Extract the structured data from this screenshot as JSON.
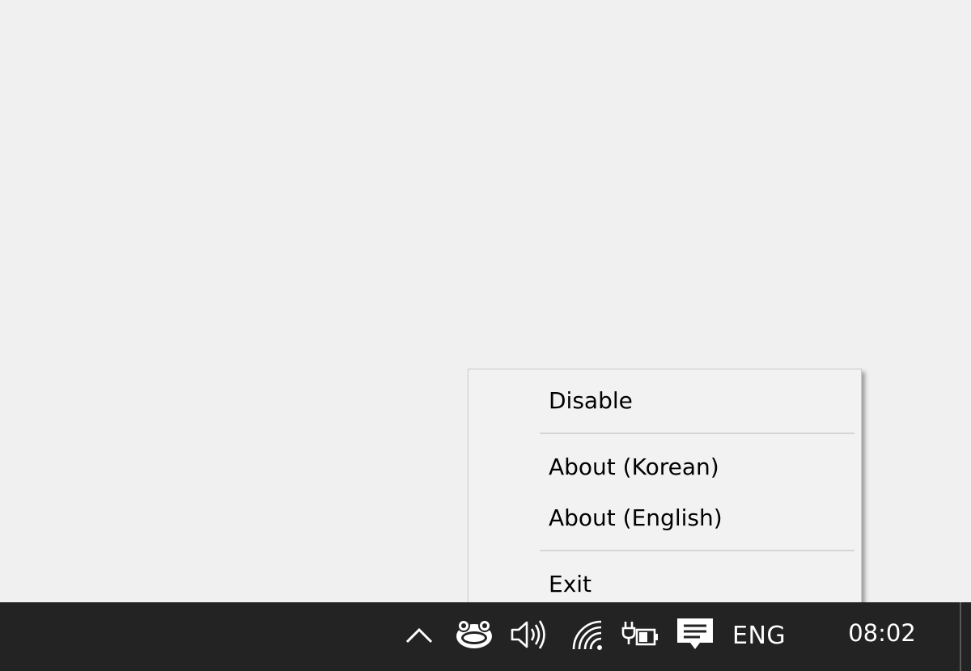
{
  "context_menu": {
    "items": [
      {
        "id": "disable",
        "label": "Disable"
      },
      {
        "id": "about-korean",
        "label": "About (Korean)"
      },
      {
        "id": "about-english",
        "label": "About (English)"
      },
      {
        "id": "exit",
        "label": "Exit"
      }
    ]
  },
  "taskbar": {
    "tray_icons": [
      {
        "name": "chevron-up-icon"
      },
      {
        "name": "app-tray-icon"
      },
      {
        "name": "volume-icon"
      },
      {
        "name": "wifi-icon"
      },
      {
        "name": "battery-charging-icon"
      },
      {
        "name": "notifications-icon"
      }
    ],
    "language": "ENG",
    "time": "08:02"
  },
  "colors": {
    "desktop": "#f0f0f0",
    "taskbar": "#232323",
    "menu_background": "#f2f2f2",
    "menu_separator": "#d6d6d6"
  }
}
